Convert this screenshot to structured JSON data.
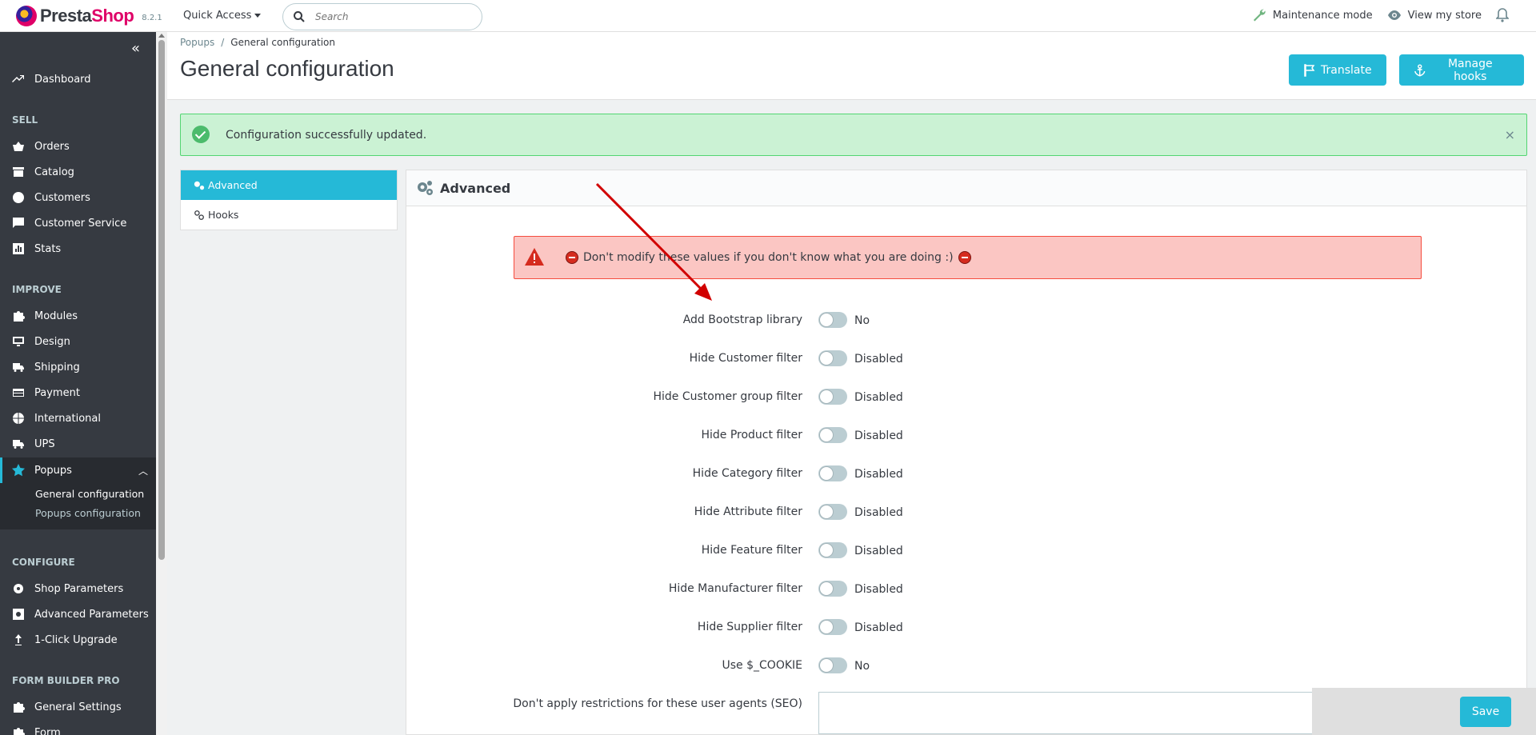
{
  "header": {
    "logo_part1": "Presta",
    "logo_part2": "Shop",
    "version": "8.2.1",
    "quick_access": "Quick Access",
    "search_placeholder": "Search",
    "maintenance": "Maintenance mode",
    "view_store": "View my store"
  },
  "sidebar": {
    "dashboard": "Dashboard",
    "sections": {
      "sell": "SELL",
      "improve": "IMPROVE",
      "configure": "CONFIGURE",
      "formbuilder": "FORM BUILDER PRO"
    },
    "sell_items": [
      "Orders",
      "Catalog",
      "Customers",
      "Customer Service",
      "Stats"
    ],
    "improve_items": [
      "Modules",
      "Design",
      "Shipping",
      "Payment",
      "International",
      "UPS"
    ],
    "popups": "Popups",
    "popups_sub": [
      "General configuration",
      "Popups configuration"
    ],
    "configure_items": [
      "Shop Parameters",
      "Advanced Parameters",
      "1-Click Upgrade"
    ],
    "formbuilder_items": [
      "General Settings",
      "Form"
    ]
  },
  "page": {
    "breadcrumb_parent": "Popups",
    "breadcrumb_sep": "/",
    "breadcrumb_current": "General configuration",
    "title": "General configuration",
    "translate_button": "Translate",
    "manage_hooks_button": "Manage hooks"
  },
  "alert_success": "Configuration successfully updated.",
  "tabs": [
    "Advanced",
    "Hooks"
  ],
  "panel": {
    "title": "Advanced",
    "warning": "Don't modify these values if you don't know what you are doing :)"
  },
  "fields": [
    {
      "label": "Add Bootstrap library",
      "value": "No"
    },
    {
      "label": "Hide Customer filter",
      "value": "Disabled"
    },
    {
      "label": "Hide Customer group filter",
      "value": "Disabled"
    },
    {
      "label": "Hide Product filter",
      "value": "Disabled"
    },
    {
      "label": "Hide Category filter",
      "value": "Disabled"
    },
    {
      "label": "Hide Attribute filter",
      "value": "Disabled"
    },
    {
      "label": "Hide Feature filter",
      "value": "Disabled"
    },
    {
      "label": "Hide Manufacturer filter",
      "value": "Disabled"
    },
    {
      "label": "Hide Supplier filter",
      "value": "Disabled"
    },
    {
      "label": "Use $_COOKIE",
      "value": "No"
    }
  ],
  "ua_field": {
    "label": "Don't apply restrictions for these user agents (SEO)",
    "value": ""
  },
  "save_button": "Save",
  "colors": {
    "primary": "#25b9d7",
    "sidebar": "#363a41",
    "success_bg": "#cbf2d4",
    "danger_bg": "#fbc6c3",
    "annotation_arrow": "#d10000"
  }
}
